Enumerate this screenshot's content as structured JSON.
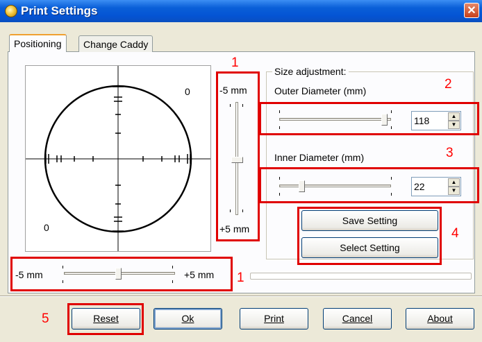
{
  "window": {
    "title": "Print Settings",
    "close_symbol": "✕"
  },
  "tabs": [
    {
      "label": "Positioning",
      "active": true
    },
    {
      "label": "Change Caddy",
      "active": false
    }
  ],
  "plot": {
    "label_top_right": "0",
    "label_bottom_left": "0"
  },
  "vertical_offset": {
    "top_label": "-5 mm",
    "bottom_label": "+5 mm",
    "annotation": "1"
  },
  "horizontal_offset": {
    "left_label": "-5 mm",
    "right_label": "+5 mm",
    "annotation": "1"
  },
  "size_adjustment": {
    "group_label": "Size adjustment:",
    "outer": {
      "label": "Outer Diameter (mm)",
      "value": "118",
      "annotation": "2"
    },
    "inner": {
      "label": "Inner Diameter (mm)",
      "value": "22",
      "annotation": "3"
    }
  },
  "settings_buttons": {
    "save": "Save Setting",
    "select": "Select Setting",
    "annotation": "4"
  },
  "footer": {
    "annotation": "5",
    "reset": "Reset",
    "ok": "Ok",
    "print": "Print",
    "cancel": "Cancel",
    "about": "About"
  },
  "colors": {
    "annotation_red": "#ff0000",
    "titlebar_blue": "#0454d4",
    "dialog_bg": "#ece9d8"
  }
}
